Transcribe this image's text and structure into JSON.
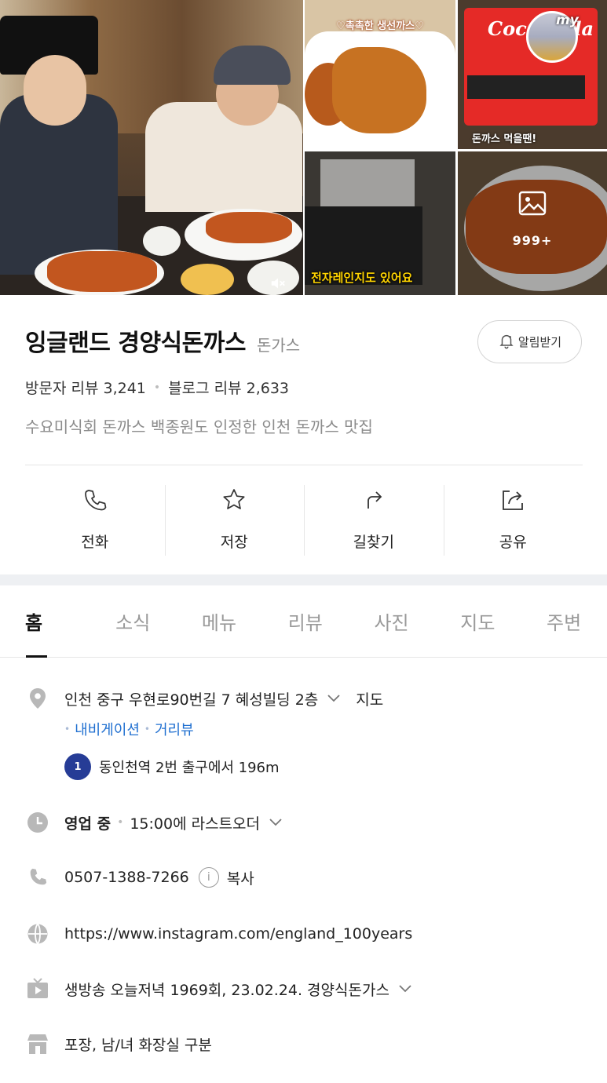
{
  "photos": {
    "caption_a": "♡촉촉한 생선까스♡",
    "caption_b": "돈까스 먹을땐!",
    "caption_c": "전자레인지도 있어요",
    "brand_sign": "Coca-Cola",
    "avatar_label": "my",
    "more_count": "999+"
  },
  "place": {
    "name": "잉글랜드 경양식돈까스",
    "category": "돈가스",
    "alarm_label": "알림받기",
    "visitor_reviews": "방문자 리뷰 3,241",
    "blog_reviews": "블로그 리뷰 2,633",
    "description": "수요미식회 돈까스 백종원도 인정한 인천 돈까스 맛집"
  },
  "actions": [
    {
      "label": "전화",
      "icon": "phone-icon"
    },
    {
      "label": "저장",
      "icon": "star-icon"
    },
    {
      "label": "길찾기",
      "icon": "directions-icon"
    },
    {
      "label": "공유",
      "icon": "share-icon"
    }
  ],
  "tabs": [
    "홈",
    "소식",
    "메뉴",
    "리뷰",
    "사진",
    "지도",
    "주변"
  ],
  "details": {
    "address": "인천 중구 우현로90번길 7 혜성빌딩 2층",
    "map_link": "지도",
    "navigation": "내비게이션",
    "street_view": "거리뷰",
    "exit_number": "1",
    "station": "동인천역 2번 출구에서 196m",
    "status": "영업 중",
    "hours_note": "15:00에 라스트오더",
    "phone": "0507-1388-7266",
    "copy": "복사",
    "website": "https://www.instagram.com/england_100years",
    "tv": "생방송 오늘저녁 1969회, 23.02.24. 경양식돈가스",
    "facilities": "포장, 남/녀 화장실 구분"
  },
  "colors": {
    "link": "#1f6fd0",
    "badge": "#263c96",
    "icon_gray": "#b8b8b8"
  }
}
